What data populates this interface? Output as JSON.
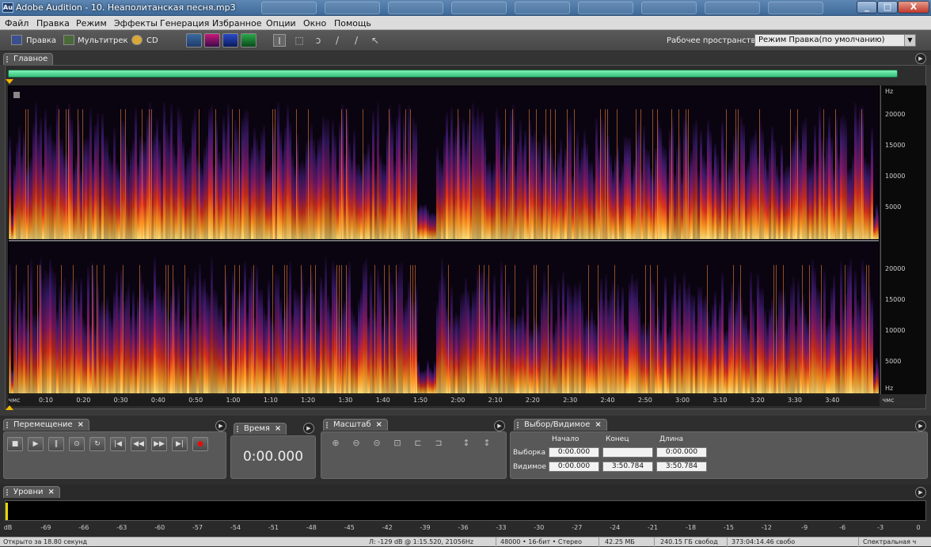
{
  "window": {
    "title": "Adobe Audition - 10. Неаполитанская песня.mp3",
    "app_icon": "Au",
    "minimize": "_",
    "maximize": "□",
    "close": "X"
  },
  "menu": [
    "Файл",
    "Правка",
    "Режим",
    "Эффекты",
    "Генерация",
    "Избранное",
    "Опции",
    "Окно",
    "Помощь"
  ],
  "toolbar": {
    "edit_label": "Правка",
    "multitrack_label": "Мультитрек",
    "cd_label": "CD",
    "workspace_label": "Рабочее пространство:",
    "workspace_value": "Режим Правка(по умолчанию)"
  },
  "main": {
    "tab_label": "Главное",
    "hz_label": "Hz",
    "hz_ticks_top": [
      "20000",
      "15000",
      "10000",
      "5000"
    ],
    "hz_ticks_bottom": [
      "20000",
      "15000",
      "10000",
      "5000"
    ],
    "hz_label_bottom": "Hz",
    "time_unit": "чмс",
    "time_ticks": [
      "0:10",
      "0:20",
      "0:30",
      "0:40",
      "0:50",
      "1:00",
      "1:10",
      "1:20",
      "1:30",
      "1:40",
      "1:50",
      "2:00",
      "2:10",
      "2:20",
      "2:30",
      "2:40",
      "2:50",
      "3:00",
      "3:10",
      "3:20",
      "3:30",
      "3:40"
    ]
  },
  "transport": {
    "tab_label": "Перемещение",
    "buttons": [
      "stop",
      "play",
      "pause",
      "play-from-cursor",
      "loop",
      "go-to-start",
      "rewind",
      "fast-forward",
      "go-to-end",
      "record"
    ]
  },
  "time": {
    "tab_label": "Время",
    "value": "0:00.000"
  },
  "zoom": {
    "tab_label": "Масштаб"
  },
  "selection": {
    "tab_label": "Выбор/Видимое",
    "col_start": "Начало",
    "col_end": "Конец",
    "col_length": "Длина",
    "row_selection": "Выборка",
    "row_view": "Видимое",
    "sel_start": "0:00.000",
    "sel_end": "",
    "sel_length": "0:00.000",
    "view_start": "0:00.000",
    "view_end": "3:50.784",
    "view_length": "3:50.784"
  },
  "levels": {
    "tab_label": "Уровни",
    "scale": [
      "dB",
      "-69",
      "-66",
      "-63",
      "-60",
      "-57",
      "-54",
      "-51",
      "-48",
      "-45",
      "-42",
      "-39",
      "-36",
      "-33",
      "-30",
      "-27",
      "-24",
      "-21",
      "-18",
      "-15",
      "-12",
      "-9",
      "-6",
      "-3",
      "0"
    ]
  },
  "status": {
    "opened": "Открыто за 18.80 секунд",
    "cursor": "Л: -129 dB @  1:15.520, 21056Hz",
    "format": "48000 • 16-бит • Стерео",
    "size": "42.25 МБ",
    "free": "240.15 ГБ свобод",
    "free_time": "373:04:14.46 свобо",
    "mode": "Спектральная ч"
  },
  "colors": {
    "accent": "#f5b800",
    "overview": "#4fd694",
    "spectrum_hot": "#ffd86b",
    "spectrum_mid": "#e0321a",
    "spectrum_low": "#3b1a6b"
  }
}
